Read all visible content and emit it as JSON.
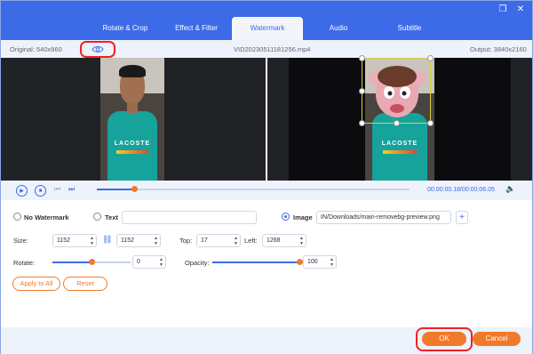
{
  "tabs": [
    {
      "label": "Rotate & Crop"
    },
    {
      "label": "Effect & Filter"
    },
    {
      "label": "Watermark"
    },
    {
      "label": "Audio"
    },
    {
      "label": "Subtitle"
    }
  ],
  "active_tab": "Watermark",
  "info": {
    "original": "Original: 540x960",
    "filename": "VID20230511181256.mp4",
    "output": "Output: 3840x2160"
  },
  "preview": {
    "left_shirt_text": "LACOSTE",
    "right_shirt_text": "LACOSTE"
  },
  "playback": {
    "time": "00:00:00.18/00:00:06.05",
    "progress": 0.12
  },
  "watermark": {
    "no_watermark_label": "No Watermark",
    "text_label": "Text",
    "text_value": "",
    "image_label": "Image",
    "image_path": "IN/Downloads/main-removebg-preview.png",
    "selected": "Image"
  },
  "size": {
    "label": "Size:",
    "width": "1152",
    "height": "1152"
  },
  "position": {
    "top_label": "Top:",
    "top": "17",
    "left_label": "Left:",
    "left": "1268"
  },
  "rotate": {
    "label": "Rotate:",
    "value": "0",
    "level": 0.5
  },
  "opacity": {
    "label": "Opacity:",
    "value": "100",
    "level": 1.0
  },
  "buttons": {
    "apply_all": "Apply to All",
    "reset": "Reset",
    "ok": "OK",
    "cancel": "Cancel"
  },
  "colors": {
    "accent": "#3d6be8",
    "orange": "#f07a2a",
    "highlight": "#e22222"
  }
}
